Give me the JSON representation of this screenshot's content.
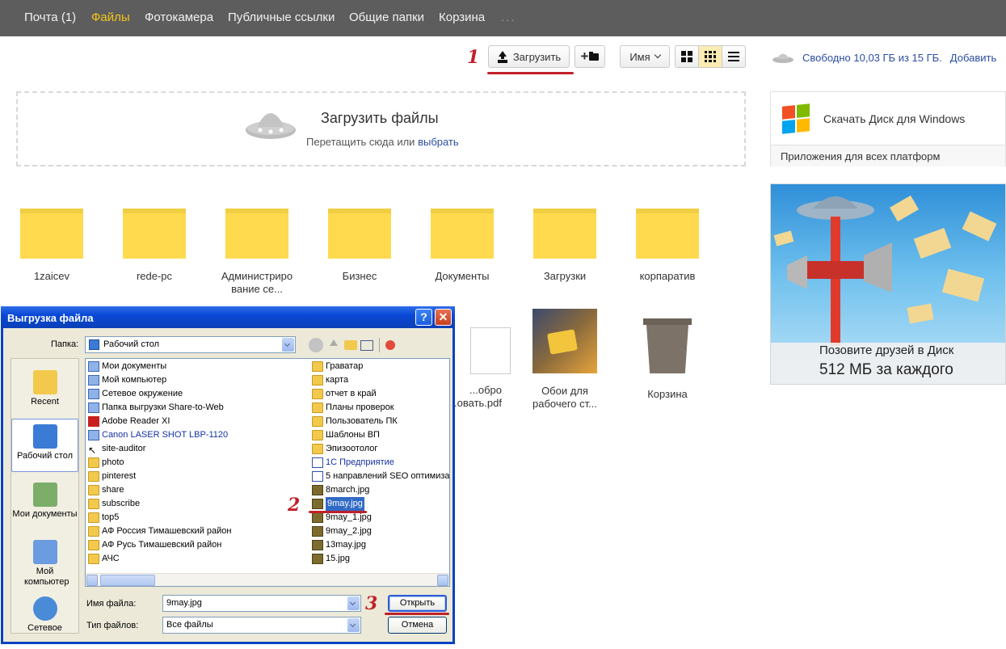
{
  "nav": {
    "items": [
      {
        "label": "Почта (1)",
        "active": false
      },
      {
        "label": "Файлы",
        "active": true
      },
      {
        "label": "Фотокамера",
        "active": false
      },
      {
        "label": "Публичные ссылки",
        "active": false
      },
      {
        "label": "Общие папки",
        "active": false
      },
      {
        "label": "Корзина",
        "active": false
      }
    ],
    "more": "..."
  },
  "toolbar": {
    "upload_label": "Загрузить",
    "new_folder_label": "+",
    "sort_label": "Имя",
    "space_text": "Свободно 10,03 ГБ из 15 ГБ.",
    "add_label": "Добавить"
  },
  "dropzone": {
    "title": "Загрузить файлы",
    "subtitle": "Перетащить сюда или",
    "link": "выбрать"
  },
  "sidebar": {
    "download_windows": "Скачать Диск для Windows",
    "all_platforms": "Приложения для всех платформ",
    "promo_line1": "Позовите друзей в Диск",
    "promo_line2": "512 МБ за каждого"
  },
  "folders": [
    {
      "name": "1zaicev"
    },
    {
      "name": "rede-pc"
    },
    {
      "name": "Администрирование се..."
    },
    {
      "name": "Бизнес"
    },
    {
      "name": "Документы"
    },
    {
      "name": "Загрузки"
    },
    {
      "name": "корпаратив"
    }
  ],
  "files_row2": [
    {
      "name": "...обро ...овать.pdf"
    },
    {
      "name": "Обои для рабочего ст..."
    },
    {
      "name": "Корзина"
    }
  ],
  "dialog": {
    "title": "Выгрузка файла",
    "help": "?",
    "close": "✕",
    "folder_label": "Папка:",
    "folder_value": "Рабочий стол",
    "places": [
      {
        "label": "Recent"
      },
      {
        "label": "Рабочий стол"
      },
      {
        "label": "Мои документы"
      },
      {
        "label": "Мой компьютер"
      },
      {
        "label": "Сетевое"
      }
    ],
    "left_column": [
      {
        "name": "Мои документы",
        "icon": "sys"
      },
      {
        "name": "Мой компьютер",
        "icon": "sys"
      },
      {
        "name": "Сетевое окружение",
        "icon": "sys"
      },
      {
        "name": "Папка выгрузки Share-to-Web",
        "icon": "sys"
      },
      {
        "name": "Adobe Reader XI",
        "icon": "pdf"
      },
      {
        "name": "Canon LASER SHOT LBP-1120",
        "icon": "sys",
        "blue": true
      },
      {
        "name": "site-auditor",
        "icon": "lnk"
      },
      {
        "name": "photo",
        "icon": "folder"
      },
      {
        "name": "pinterest",
        "icon": "folder"
      },
      {
        "name": "share",
        "icon": "folder"
      },
      {
        "name": "subscribe",
        "icon": "folder"
      },
      {
        "name": "top5",
        "icon": "folder"
      },
      {
        "name": "АФ Россия Тимашевский район",
        "icon": "folder"
      },
      {
        "name": "АФ Русь Тимашевский район",
        "icon": "folder"
      },
      {
        "name": "АЧС",
        "icon": "folder"
      }
    ],
    "right_column": [
      {
        "name": "Граватар",
        "icon": "folder"
      },
      {
        "name": "карта",
        "icon": "folder"
      },
      {
        "name": "отчет в край",
        "icon": "folder"
      },
      {
        "name": "Планы проверок",
        "icon": "folder"
      },
      {
        "name": "Пользователь ПК",
        "icon": "folder"
      },
      {
        "name": "Шаблоны ВП",
        "icon": "folder"
      },
      {
        "name": "Эпизоотолог",
        "icon": "folder"
      },
      {
        "name": "1С Предприятие",
        "icon": "doc",
        "blue": true
      },
      {
        "name": "5 направлений SEO оптимиза",
        "icon": "doc"
      },
      {
        "name": "8march.jpg",
        "icon": "jpg"
      },
      {
        "name": "9may.jpg",
        "icon": "jpg",
        "selected": true
      },
      {
        "name": "9may_1.jpg",
        "icon": "jpg"
      },
      {
        "name": "9may_2.jpg",
        "icon": "jpg"
      },
      {
        "name": "13may.jpg",
        "icon": "jpg"
      },
      {
        "name": "15.jpg",
        "icon": "jpg"
      }
    ],
    "filename_label": "Имя файла:",
    "filename_value": "9may.jpg",
    "filetype_label": "Тип файлов:",
    "filetype_value": "Все файлы",
    "open_label": "Открыть",
    "cancel_label": "Отмена"
  },
  "annotations": {
    "step1": "1",
    "step2": "2",
    "step3": "3"
  },
  "colors": {
    "accent": "#f5c518",
    "link": "#2b4ea0",
    "annotation": "#c0202a",
    "folder": "#ffd94e"
  }
}
